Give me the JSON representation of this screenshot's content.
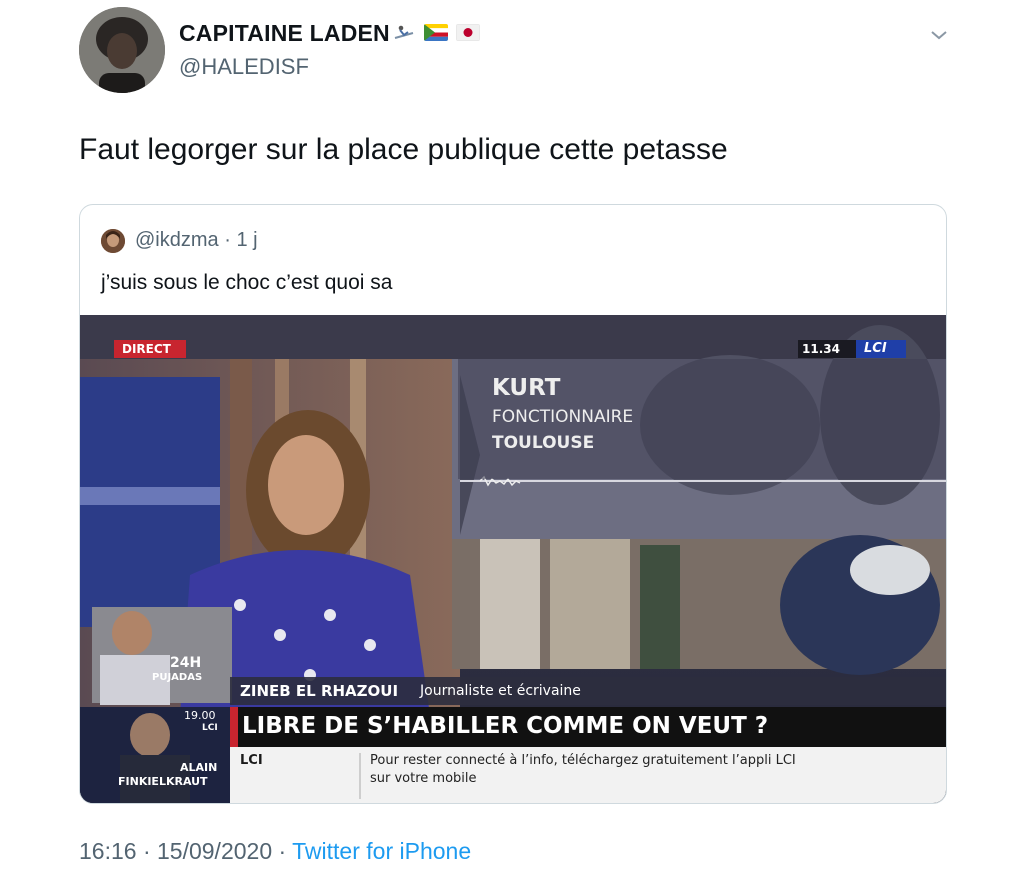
{
  "tweet": {
    "author_name": "CAPITAINE LADEN",
    "author_handle": "@HALEDISF",
    "flags": [
      "ski-emoji",
      "comoros-flag",
      "japan-flag"
    ],
    "text": "Faut legorger sur la place publique cette petasse",
    "timestamp": "16:16 · 15/09/2020 · ",
    "source": "Twitter for iPhone"
  },
  "quoted": {
    "handle": "@ikdzma",
    "age": "1 j",
    "text": "j’suis sous le choc c’est quoi sa"
  },
  "video": {
    "direct_badge": "DIRECT",
    "clock": "11.34",
    "channel_logo": "LCI",
    "caller_name": "KURT",
    "caller_job": "FONCTIONNAIRE",
    "caller_city": "TOULOUSE",
    "guest_name": "ZINEB EL RHAZOUI",
    "guest_role": "Journaliste et écrivaine",
    "promo_24h": "24H",
    "promo_pujadas": "PUJADAS",
    "promo_time": "19.00",
    "promo_lci": "LCI",
    "promo_alain": "ALAIN",
    "promo_finkielkraut": "FINKIELKRAUT",
    "headline": "LIBRE DE S’HABILLER COMME ON VEUT ?",
    "ticker_channel": "LCI",
    "ticker_line1": "Pour rester connecté à l’info, téléchargez gratuitement l’appli LCI",
    "ticker_line2": "sur votre mobile"
  },
  "colors": {
    "link_blue": "#1d9bf0",
    "secondary_gray": "#536471",
    "lci_red": "#c8252f",
    "lci_blue": "#1f3fa8"
  }
}
